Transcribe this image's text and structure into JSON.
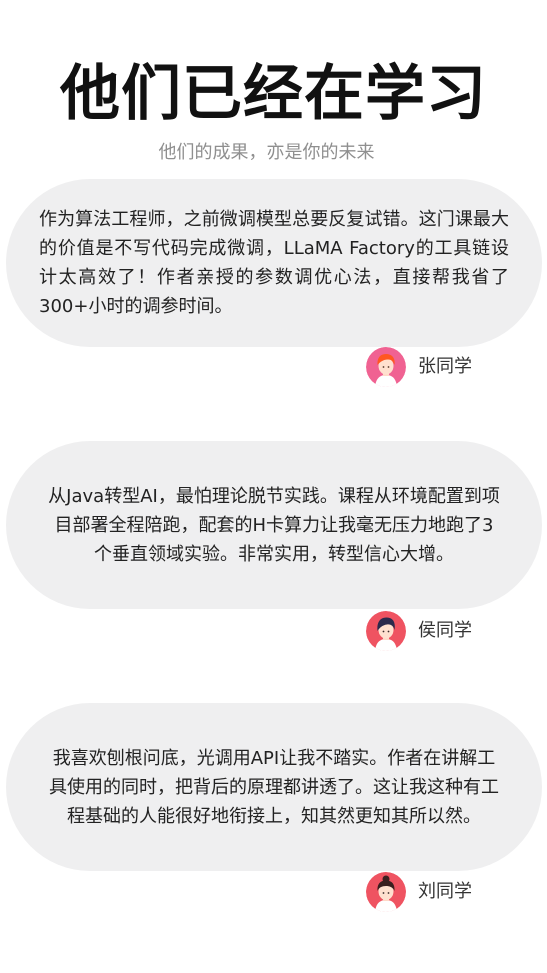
{
  "header": {
    "title": "他们已经在学习",
    "subtitle": "他们的成果，亦是你的未来"
  },
  "testimonials": [
    {
      "text": "作为算法工程师，之前微调模型总要反复试错。这门课最大的价值是不写代码完成微调，LLaMA Factory的工具链设计太高效了！作者亲授的参数调优心法，直接帮我省了300+小时的调参时间。",
      "author": "张同学",
      "avatar_icon": "student-avatar-orange-hair-icon",
      "avatar_color": "#f06292"
    },
    {
      "text": "从Java转型AI，最怕理论脱节实践。课程从环境配置到项目部署全程陪跑，配套的H卡算力让我毫无压力地跑了3个垂直领域实验。非常实用，转型信心大增。",
      "author": "侯同学",
      "avatar_icon": "student-avatar-dark-hair-icon",
      "avatar_color": "#ef5361"
    },
    {
      "text": "我喜欢刨根问底，光调用API让我不踏实。作者在讲解工具使用的同时，把背后的原理都讲透了。这让我这种有工程基础的人能很好地衔接上，知其然更知其所以然。",
      "author": "刘同学",
      "avatar_icon": "student-avatar-bun-hair-icon",
      "avatar_color": "#ef5361"
    }
  ]
}
